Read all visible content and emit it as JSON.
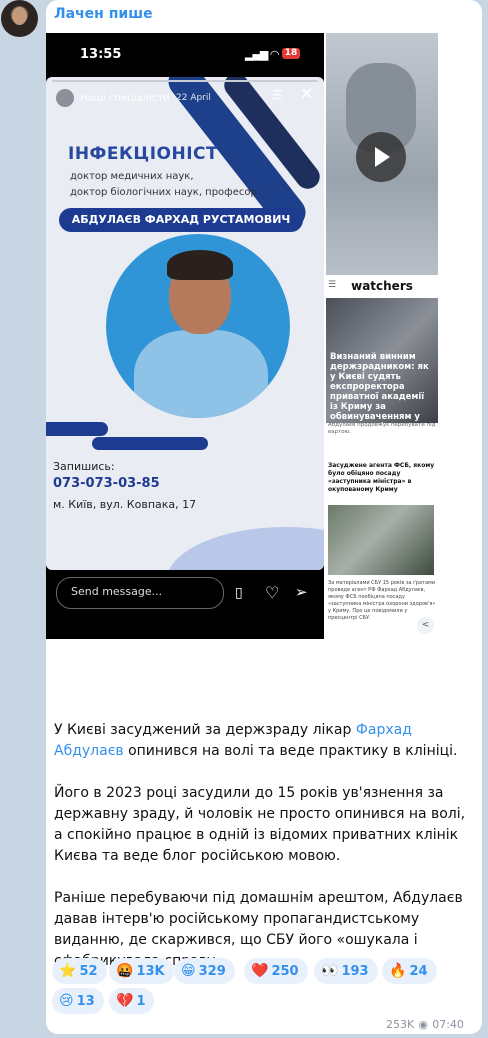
{
  "channel": {
    "author": "Лачен пише"
  },
  "story": {
    "time": "13:55",
    "battery": "18",
    "account": "Наші спеціалісти",
    "date": "22 April",
    "specialty": "ІНФЕКЦІОНІСТ",
    "degree_line1": "доктор медичних наук,",
    "degree_line2": "доктор біологічних наук, професор",
    "doctor_name": "АБДУЛАЄВ ФАРХАД РУСТАМОВИЧ",
    "signup": "Запишись:",
    "phone": "073-073-03-85",
    "address": "м. Київ, вул. Ковпака, 17",
    "message_placeholder": "Send message..."
  },
  "news": {
    "brand": "watchers",
    "headline": "Визнаний винним держзрадником: як у Києві судять експроректора приватної академії із Криму за обвинуваченням у держзраді",
    "caption": "Абдулаєв продовжує перебувати під вартою.",
    "headline2": "Засуджене агента ФСБ, якому було обіцяно посаду «заступника міністра» в окупованому Криму",
    "paragraph": "За матеріалами СБУ 15 років за ґратами проведе агент РФ Фархад Абдулаєв, якому ФСБ пообіцяла посаду «заступника міністра охорони здоров'я» у Криму. Про це повідомили у пресцентрі СБУ."
  },
  "post": {
    "para1_prefix": "У Києві засуджений за держзраду лікар ",
    "para1_link": "Фархад Абдулаєв",
    "para1_suffix": " опинився на волі та веде практику в клініці.",
    "para2": "Його в 2023 році засудили до 15 років ув'язнення за державну зраду, й чоловік не просто опинився на волі, а спокійно працює в одній із відомих приватних клінік Києва та веде блог російською мовою.",
    "para3": "Раніше перебуваючи під домашнім арештом, Абдулаєв давав інтерв'ю російському пропагандистському виданню, де скаржився, що СБУ його «ошукала і сфабрикувала справу»."
  },
  "reactions": [
    {
      "emoji": "⭐",
      "count": "52"
    },
    {
      "emoji": "🤬",
      "count": "13K"
    },
    {
      "emoji": "😁",
      "count": "329"
    },
    {
      "emoji": "❤️",
      "count": "250"
    },
    {
      "emoji": "👀",
      "count": "193"
    },
    {
      "emoji": "🔥",
      "count": "24"
    },
    {
      "emoji": "😢",
      "count": "13"
    },
    {
      "emoji": "💔",
      "count": "1"
    }
  ],
  "meta": {
    "views": "253K",
    "time": "07:40"
  }
}
